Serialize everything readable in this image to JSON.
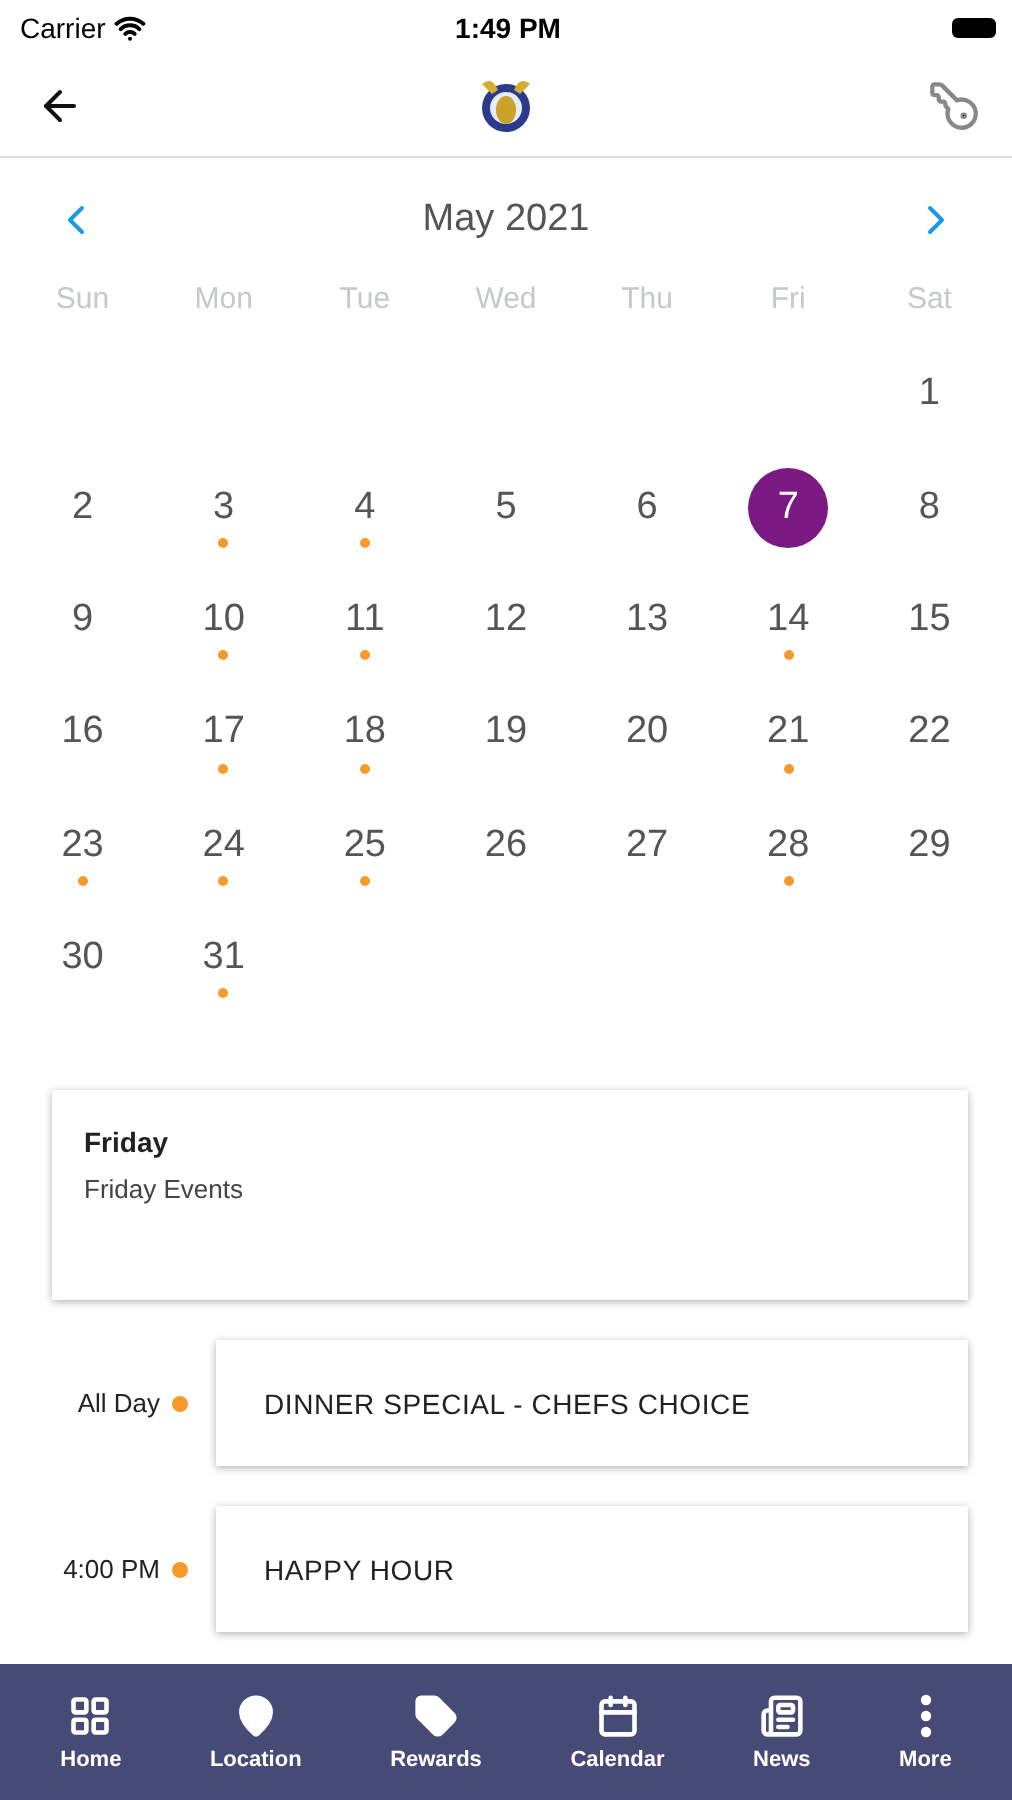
{
  "status_bar": {
    "carrier": "Carrier",
    "time": "1:49 PM"
  },
  "calendar": {
    "month": "May 2021",
    "weekdays": [
      "Sun",
      "Mon",
      "Tue",
      "Wed",
      "Thu",
      "Fri",
      "Sat"
    ],
    "weeks": [
      [
        {
          "day": "1",
          "event": false,
          "selected": false
        }
      ],
      [
        {
          "day": "2",
          "event": false,
          "selected": false
        },
        {
          "day": "3",
          "event": true,
          "selected": false
        },
        {
          "day": "4",
          "event": true,
          "selected": false
        },
        {
          "day": "5",
          "event": false,
          "selected": false
        },
        {
          "day": "6",
          "event": false,
          "selected": false
        },
        {
          "day": "7",
          "event": false,
          "selected": true
        },
        {
          "day": "8",
          "event": false,
          "selected": false
        }
      ],
      [
        {
          "day": "9",
          "event": false,
          "selected": false
        },
        {
          "day": "10",
          "event": true,
          "selected": false
        },
        {
          "day": "11",
          "event": true,
          "selected": false
        },
        {
          "day": "12",
          "event": false,
          "selected": false
        },
        {
          "day": "13",
          "event": false,
          "selected": false
        },
        {
          "day": "14",
          "event": true,
          "selected": false
        },
        {
          "day": "15",
          "event": false,
          "selected": false
        }
      ],
      [
        {
          "day": "16",
          "event": false,
          "selected": false
        },
        {
          "day": "17",
          "event": true,
          "selected": false
        },
        {
          "day": "18",
          "event": true,
          "selected": false
        },
        {
          "day": "19",
          "event": false,
          "selected": false
        },
        {
          "day": "20",
          "event": false,
          "selected": false
        },
        {
          "day": "21",
          "event": true,
          "selected": false
        },
        {
          "day": "22",
          "event": false,
          "selected": false
        }
      ],
      [
        {
          "day": "23",
          "event": true,
          "selected": false
        },
        {
          "day": "24",
          "event": true,
          "selected": false
        },
        {
          "day": "25",
          "event": true,
          "selected": false
        },
        {
          "day": "26",
          "event": false,
          "selected": false
        },
        {
          "day": "27",
          "event": false,
          "selected": false
        },
        {
          "day": "28",
          "event": true,
          "selected": false
        },
        {
          "day": "29",
          "event": false,
          "selected": false
        }
      ],
      [
        {
          "day": "30",
          "event": false,
          "selected": false
        },
        {
          "day": "31",
          "event": true,
          "selected": false
        }
      ]
    ]
  },
  "day_card": {
    "title": "Friday",
    "subtitle": "Friday Events"
  },
  "events": [
    {
      "time": "All Day",
      "title": "DINNER SPECIAL - CHEFS CHOICE"
    },
    {
      "time": "4:00 PM",
      "title": "HAPPY HOUR"
    }
  ],
  "tab_bar": [
    {
      "label": "Home",
      "kind": "grid"
    },
    {
      "label": "Location",
      "kind": "pin"
    },
    {
      "label": "Rewards",
      "kind": "tag"
    },
    {
      "label": "Calendar",
      "kind": "calendar"
    },
    {
      "label": "News",
      "kind": "news"
    },
    {
      "label": "More",
      "kind": "more"
    }
  ]
}
